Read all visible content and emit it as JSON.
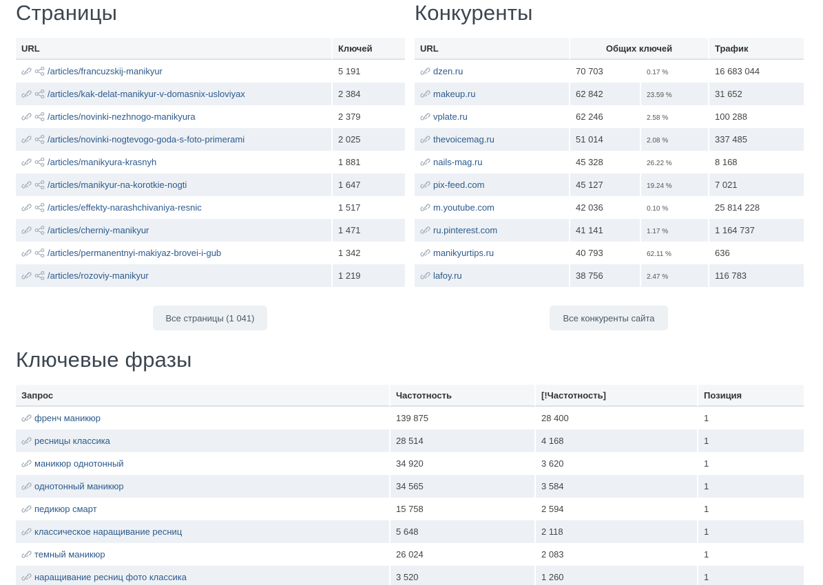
{
  "pages": {
    "title": "Страницы",
    "headers": {
      "url": "URL",
      "keys": "Ключей"
    },
    "rows": [
      {
        "url": "/articles/francuzskij-manikyur",
        "keys": "5 191"
      },
      {
        "url": "/articles/kak-delat-manikyur-v-domasnix-usloviyax",
        "keys": "2 384"
      },
      {
        "url": "/articles/novinki-nezhnogo-manikyura",
        "keys": "2 379"
      },
      {
        "url": "/articles/novinki-nogtevogo-goda-s-foto-primerami",
        "keys": "2 025"
      },
      {
        "url": "/articles/manikyura-krasnyh",
        "keys": "1 881"
      },
      {
        "url": "/articles/manikyur-na-korotkie-nogti",
        "keys": "1 647"
      },
      {
        "url": "/articles/effekty-narashchivaniya-resnic",
        "keys": "1 517"
      },
      {
        "url": "/articles/cherniy-manikyur",
        "keys": "1 471"
      },
      {
        "url": "/articles/permanentnyi-makiyaz-brovei-i-gub",
        "keys": "1 342"
      },
      {
        "url": "/articles/rozoviy-manikyur",
        "keys": "1 219"
      }
    ],
    "button": "Все страницы (1 041)"
  },
  "competitors": {
    "title": "Конкуренты",
    "headers": {
      "url": "URL",
      "common": "Общих ключей",
      "traffic": "Трафик"
    },
    "rows": [
      {
        "domain": "dzen.ru",
        "common": "70 703",
        "pct": "0.17 %",
        "traffic": "16 683 044"
      },
      {
        "domain": "makeup.ru",
        "common": "62 842",
        "pct": "23.59 %",
        "traffic": "31 652"
      },
      {
        "domain": "vplate.ru",
        "common": "62 246",
        "pct": "2.58 %",
        "traffic": "100 288"
      },
      {
        "domain": "thevoicemag.ru",
        "common": "51 014",
        "pct": "2.08 %",
        "traffic": "337 485"
      },
      {
        "domain": "nails-mag.ru",
        "common": "45 328",
        "pct": "26.22 %",
        "traffic": "8 168"
      },
      {
        "domain": "pix-feed.com",
        "common": "45 127",
        "pct": "19.24 %",
        "traffic": "7 021"
      },
      {
        "domain": "m.youtube.com",
        "common": "42 036",
        "pct": "0.10 %",
        "traffic": "25 814 228"
      },
      {
        "domain": "ru.pinterest.com",
        "common": "41 141",
        "pct": "1.17 %",
        "traffic": "1 164 737"
      },
      {
        "domain": "manikyurtips.ru",
        "common": "40 793",
        "pct": "62.11 %",
        "traffic": "636"
      },
      {
        "domain": "lafoy.ru",
        "common": "38 756",
        "pct": "2.47 %",
        "traffic": "116 783"
      }
    ],
    "button": "Все конкуренты сайта"
  },
  "keywords": {
    "title": "Ключевые фразы",
    "headers": {
      "query": "Запрос",
      "freq": "Частотность",
      "exact": "[!Частотность]",
      "pos": "Позиция"
    },
    "rows": [
      {
        "query": "френч маникюр",
        "freq": "139 875",
        "exact": "28 400",
        "pos": "1"
      },
      {
        "query": "ресницы классика",
        "freq": "28 514",
        "exact": "4 168",
        "pos": "1"
      },
      {
        "query": "маникюр однотонный",
        "freq": "34 920",
        "exact": "3 620",
        "pos": "1"
      },
      {
        "query": "однотонный маникюр",
        "freq": "34 565",
        "exact": "3 584",
        "pos": "1"
      },
      {
        "query": "педикюр смарт",
        "freq": "15 758",
        "exact": "2 594",
        "pos": "1"
      },
      {
        "query": "классическое наращивание ресниц",
        "freq": "5 648",
        "exact": "2 118",
        "pos": "1"
      },
      {
        "query": "темный маникюр",
        "freq": "26 024",
        "exact": "2 083",
        "pos": "1"
      },
      {
        "query": "наращивание ресниц фото классика",
        "freq": "3 520",
        "exact": "1 260",
        "pos": "1"
      }
    ]
  },
  "icons": {
    "link": "link-icon",
    "share": "share-icon"
  },
  "colors": {
    "link": "#2d5a8c",
    "row_alt": "#edf1f5",
    "header_bg": "#f4f6f8",
    "button_bg": "#eef1f4"
  }
}
